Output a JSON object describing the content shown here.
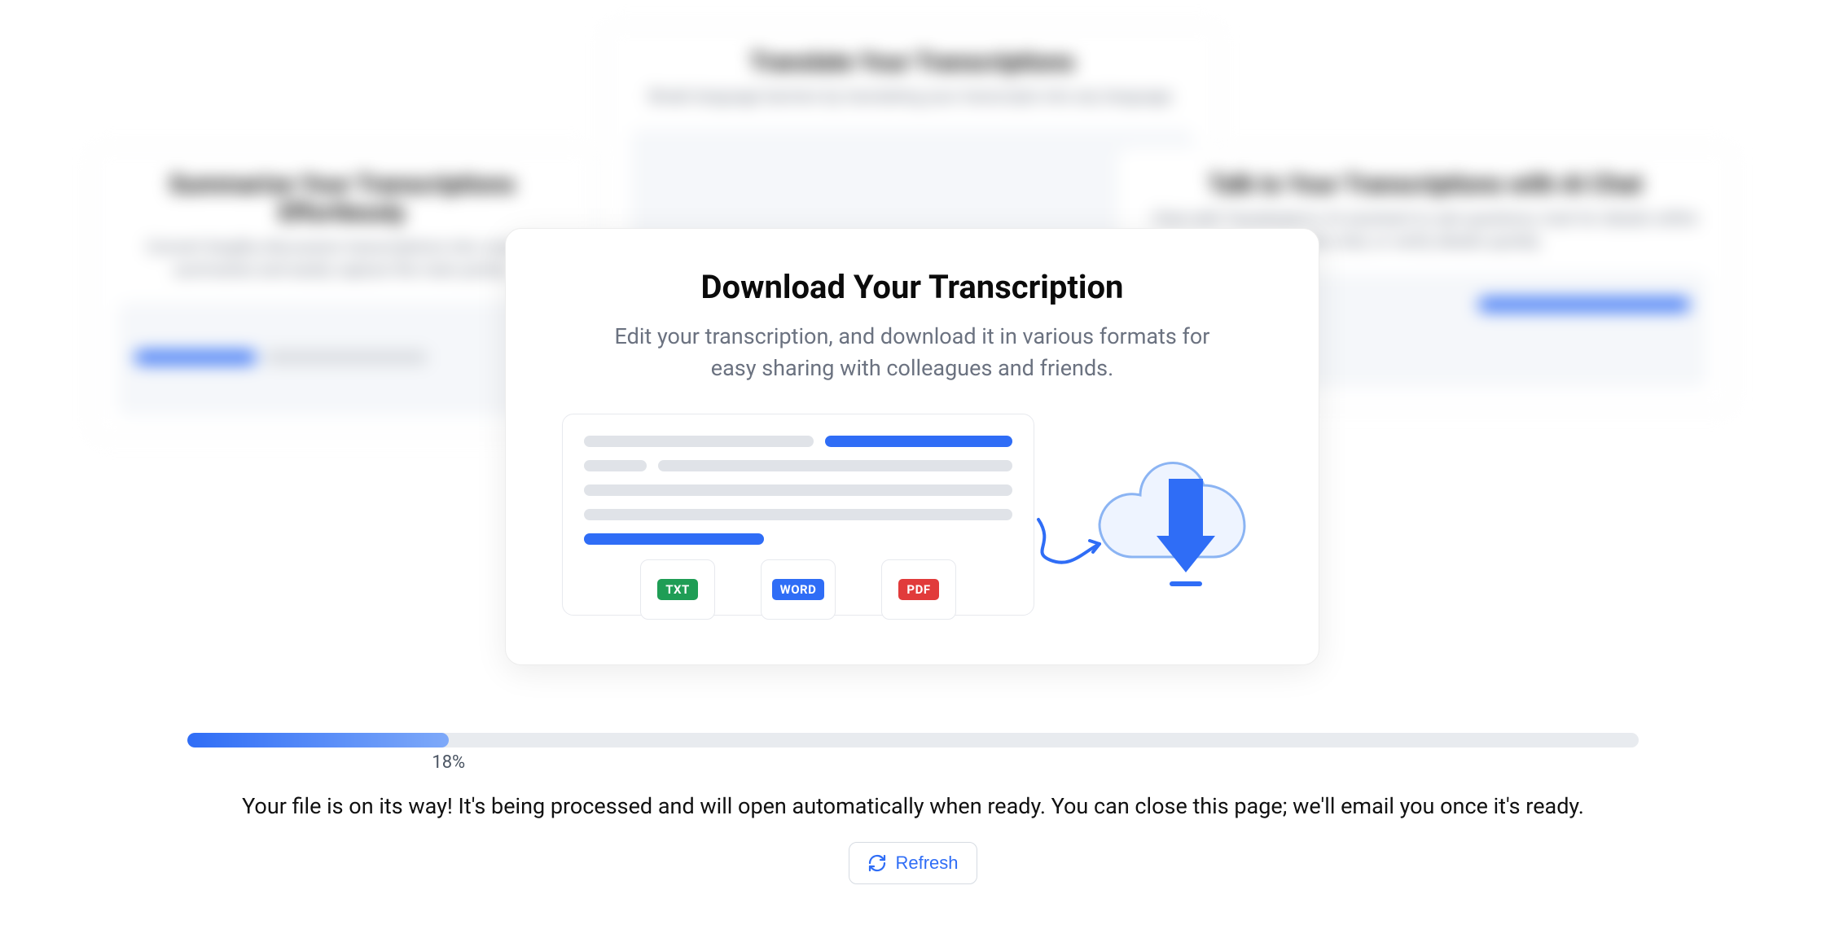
{
  "background_cards": {
    "top": {
      "title": "Translate Your Transcriptions",
      "desc": "Break language barriers by translating your transcripts into any language."
    },
    "left": {
      "title": "Summarize Your Transcriptions Effortlessly",
      "desc": "Convert lengthy discussion transcriptions into concise summaries and easily capture the main points."
    },
    "right": {
      "title": "Talk to Your Transcriptions with AI Chat",
      "desc": "Chat with Transkriptor's AI assistant to ask questions, look for details within the chat, or verify details quickly."
    }
  },
  "card": {
    "title": "Download Your Transcription",
    "subtitle": "Edit your transcription, and download it in various formats for easy sharing with colleagues and friends.",
    "formats": {
      "txt": "TXT",
      "word": "WORD",
      "pdf": "PDF"
    }
  },
  "progress": {
    "percent": 18,
    "percent_label": "18%",
    "status_text": "Your file is on its way! It's being processed and will open automatically when ready. You can close this page; we'll email you once it's ready.",
    "refresh_label": "Refresh"
  }
}
